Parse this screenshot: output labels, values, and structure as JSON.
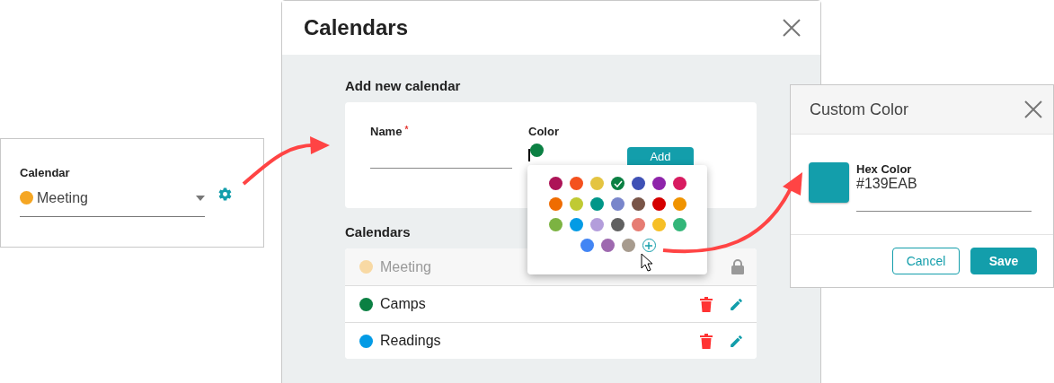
{
  "calendar_select": {
    "label": "Calendar",
    "value": "Meeting",
    "color": "#f5a623"
  },
  "dialog": {
    "title": "Calendars",
    "add_section": {
      "title": "Add new calendar",
      "name_label": "Name",
      "required_mark": "*",
      "color_label": "Color",
      "color": "#0b8043",
      "button": "Add"
    },
    "palette": [
      {
        "color": "#ad1457",
        "selected": false
      },
      {
        "color": "#f4511e",
        "selected": false
      },
      {
        "color": "#e4c441",
        "selected": false
      },
      {
        "color": "#0b8043",
        "selected": true
      },
      {
        "color": "#3f51b5",
        "selected": false
      },
      {
        "color": "#8e24aa",
        "selected": false
      },
      {
        "color": "#d81b60",
        "selected": false
      },
      {
        "color": "#ef6c00",
        "selected": false
      },
      {
        "color": "#c0ca33",
        "selected": false
      },
      {
        "color": "#009688",
        "selected": false
      },
      {
        "color": "#7986cb",
        "selected": false
      },
      {
        "color": "#795548",
        "selected": false
      },
      {
        "color": "#d50000",
        "selected": false
      },
      {
        "color": "#f09300",
        "selected": false
      },
      {
        "color": "#7cb342",
        "selected": false
      },
      {
        "color": "#039be5",
        "selected": false
      },
      {
        "color": "#b39ddb",
        "selected": false
      },
      {
        "color": "#616161",
        "selected": false
      },
      {
        "color": "#e67c73",
        "selected": false
      },
      {
        "color": "#f6bf26",
        "selected": false
      },
      {
        "color": "#33b679",
        "selected": false
      },
      {
        "color": "#4285f4",
        "selected": false
      },
      {
        "color": "#9e69af",
        "selected": false
      },
      {
        "color": "#a79b8e",
        "selected": false
      }
    ],
    "list_title": "Calendars",
    "calendars": [
      {
        "name": "Meeting",
        "color": "#f8d9a4",
        "locked": true
      },
      {
        "name": "Camps",
        "color": "#0b8043",
        "locked": false
      },
      {
        "name": "Readings",
        "color": "#039be5",
        "locked": false
      }
    ]
  },
  "custom_color": {
    "title": "Custom Color",
    "label": "Hex Color",
    "value": "#139EAB",
    "color": "#139eab",
    "buttons": [
      {
        "label": "Cancel",
        "kind": "outline"
      },
      {
        "label": "Save",
        "kind": "primary"
      }
    ]
  }
}
